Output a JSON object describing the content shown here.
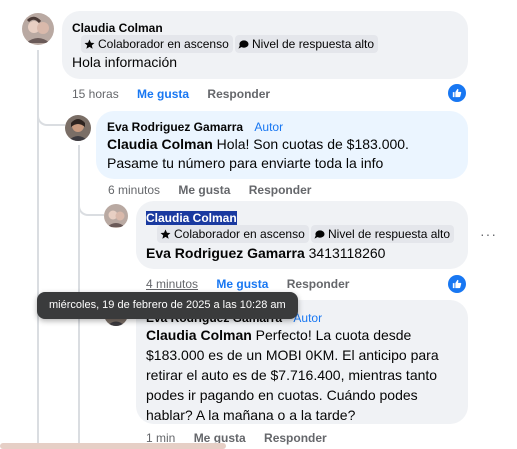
{
  "comments": [
    {
      "name": "Claudia Colman",
      "badges": [
        "Colaborador en ascenso",
        "Nivel de respuesta alto"
      ],
      "text": "Hola información",
      "time": "15 horas",
      "like": "Me gusta",
      "reply": "Responder"
    },
    {
      "name": "Eva Rodriguez Gamarra",
      "author": "Autor",
      "mention": "Claudia Colman",
      "text": " Hola! Son cuotas de $183.000. Pasame tu número para enviarte toda la info",
      "time": "6 minutos",
      "like": "Me gusta",
      "reply": "Responder"
    },
    {
      "name": "Claudia Colman",
      "badges": [
        "Colaborador en ascenso",
        "Nivel de respuesta alto"
      ],
      "mention": "Eva Rodriguez Gamarra",
      "text": " 3413118260",
      "time": "4 minutos",
      "like": "Me gusta",
      "reply": "Responder"
    },
    {
      "name": "Eva Rodriguez Gamarra",
      "author": "Autor",
      "mention": "Claudia Colman",
      "text": " Perfecto! La cuota desde $183.000 es de un MOBI 0KM. El anticipo para retirar el auto es de $7.716.400, mientras tanto podes ir pagando en cuotas. Cuándo podes hablar? A la mañana o a la tarde?",
      "time": "1 min",
      "like": "Me gusta",
      "reply": "Responder"
    }
  ],
  "tooltip": "miércoles, 19 de febrero de 2025 a las 10:28 am",
  "more_options": "···",
  "colors": {
    "link_blue": "#1877f2",
    "bubble_gray": "#f0f2f5",
    "bubble_blue": "#ebf5ff"
  }
}
